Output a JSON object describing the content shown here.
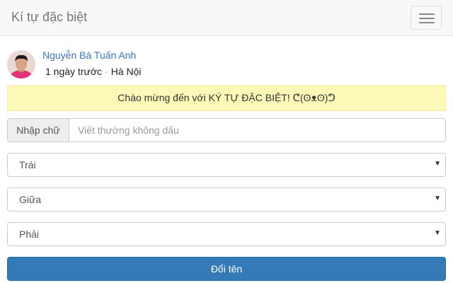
{
  "navbar": {
    "brand": "Kí tự đặc biệt",
    "menu_icon": "hamburger-icon"
  },
  "author": {
    "name": "Nguyễn Bá Tuấn Anh",
    "time": "1 ngày trước",
    "separator": "·",
    "location": "Hà Nội"
  },
  "alert": {
    "text": "Chào mừng đến với KÝ TỰ ĐẶC BIỆT! ᕦ(ʘᴥʘ)ᕤ"
  },
  "input": {
    "addon": "Nhập chữ",
    "value": "",
    "placeholder": "Viết thường không dấu"
  },
  "selects": {
    "left": {
      "selected": "Trái"
    },
    "middle": {
      "selected": "Giữa"
    },
    "right": {
      "selected": "Phải"
    },
    "arrow": "▼"
  },
  "submit": {
    "label": "Đổi tên"
  },
  "colors": {
    "link": "#3b73b9",
    "alert_bg": "#fcf8b8",
    "button_bg": "#337ab7"
  }
}
